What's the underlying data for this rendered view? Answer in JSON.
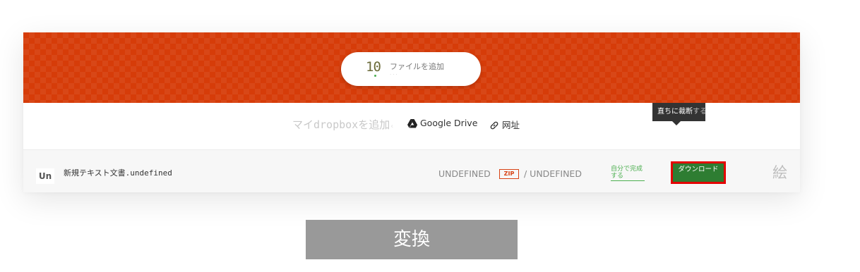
{
  "uploader": {
    "file_count": "10",
    "add_files_label": "ファイルを追加",
    "add_files_sub": "..."
  },
  "sources": {
    "dropbox_label": "マイdropboxを追加",
    "dropbox_tail": "‹",
    "gdrive_label": "Google Drive",
    "url_label": "网址"
  },
  "file_row": {
    "ext_badge": "Un",
    "file_name": "新規テキスト文書.undefined",
    "from_format": "UNDEFINED",
    "archive_tag": "ZIP",
    "to_format": "/ UNDEFINED",
    "self_complete_label": "自分で完成する",
    "download_label": "ダウンロード",
    "tooltip_text": "直ちに裁断",
    "tooltip_fade": "する",
    "type_icon_glyph": "絵"
  },
  "convert_button": "変換",
  "colors": {
    "hero": "#d63c09",
    "download_bg": "#2e7d32",
    "download_border": "#e30000",
    "convert_bg": "#999999"
  }
}
